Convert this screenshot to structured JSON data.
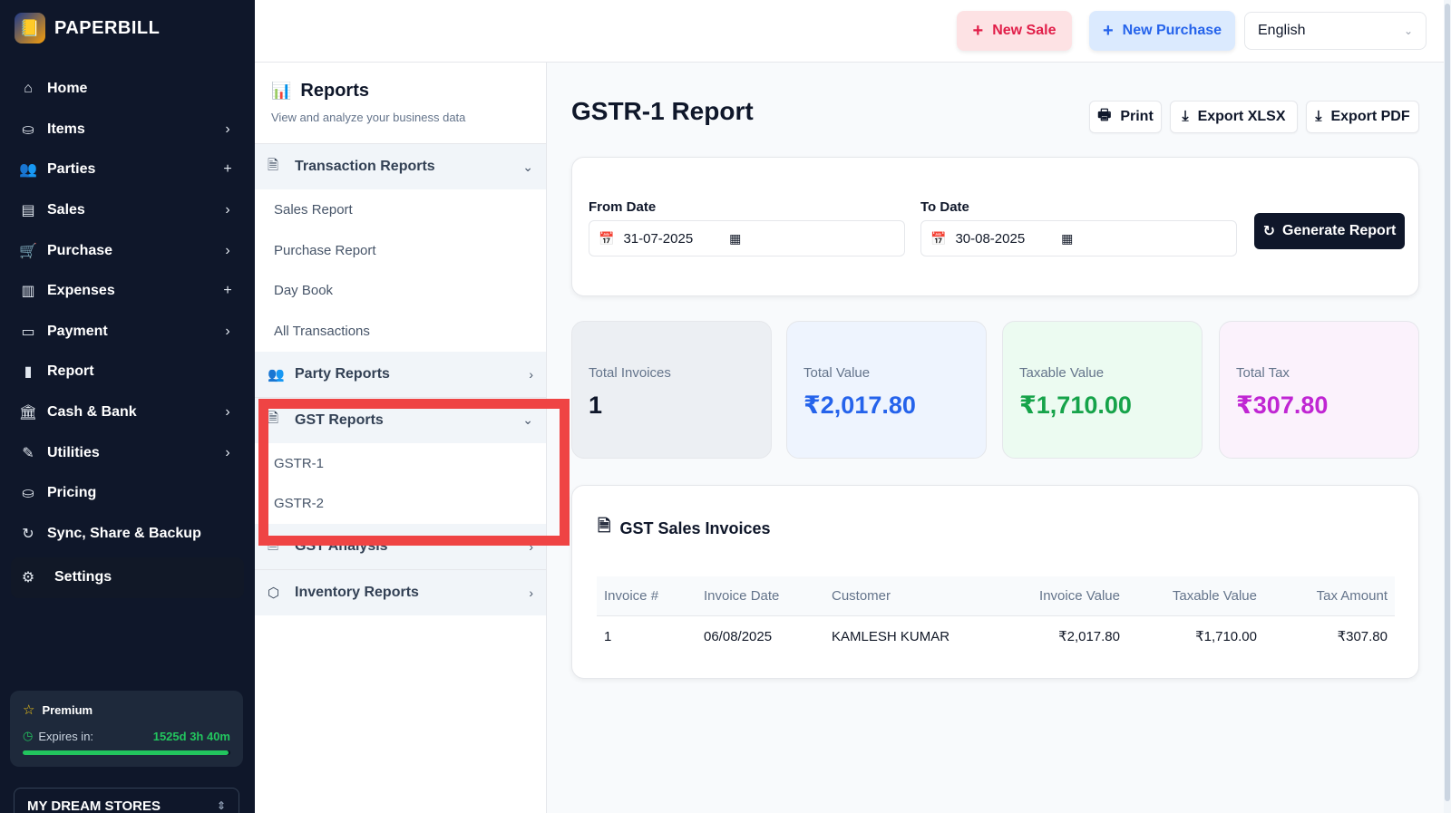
{
  "brand": {
    "name": "PAPERBILL",
    "logo_icon": "📒"
  },
  "sidebar": {
    "items": [
      {
        "label": "Home",
        "icon": "⌂",
        "right": "",
        "name": "home"
      },
      {
        "label": "Items",
        "icon": "⛀",
        "right": "›",
        "name": "items"
      },
      {
        "label": "Parties",
        "icon": "👥",
        "right": "+",
        "name": "parties"
      },
      {
        "label": "Sales",
        "icon": "▤",
        "right": "›",
        "name": "sales"
      },
      {
        "label": "Purchase",
        "icon": "🛒",
        "right": "›",
        "name": "purchase"
      },
      {
        "label": "Expenses",
        "icon": "▥",
        "right": "+",
        "name": "expenses"
      },
      {
        "label": "Payment",
        "icon": "▭",
        "right": "›",
        "name": "payment"
      },
      {
        "label": "Report",
        "icon": "▮",
        "right": "",
        "name": "report"
      },
      {
        "label": "Cash & Bank",
        "icon": "🏛",
        "right": "›",
        "name": "cash-bank"
      },
      {
        "label": "Utilities",
        "icon": "✎",
        "right": "›",
        "name": "utilities"
      },
      {
        "label": "Pricing",
        "icon": "⛀",
        "right": "",
        "name": "pricing"
      },
      {
        "label": "Sync, Share & Backup",
        "icon": "↻",
        "right": "",
        "name": "sync"
      }
    ],
    "settings_label": "Settings",
    "premium": {
      "label": "Premium",
      "expires_label": "Expires in:",
      "expires_value": "1525d 3h 40m",
      "remaining_fraction": 0.99
    },
    "store_name": "MY DREAM STORES"
  },
  "topbar": {
    "new_sale": "New Sale",
    "new_purchase": "New Purchase",
    "language": "English"
  },
  "reports_panel": {
    "title": "Reports",
    "subtitle": "View and analyze your business data",
    "transaction_reports": {
      "label": "Transaction Reports",
      "items": [
        "Sales Report",
        "Purchase Report",
        "Day Book",
        "All Transactions"
      ]
    },
    "party_reports": "Party Reports",
    "gst_reports": {
      "label": "GST Reports",
      "items": [
        "GSTR-1",
        "GSTR-2"
      ]
    },
    "gst_analysis": "GST Analysis",
    "inventory_reports": "Inventory Reports"
  },
  "main": {
    "title": "GSTR-1 Report",
    "print": "Print",
    "export_xlsx": "Export XLSX",
    "export_pdf": "Export PDF",
    "from_date_label": "From Date",
    "from_date": "31-07-2025",
    "to_date_label": "To Date",
    "to_date": "30-08-2025",
    "generate": "Generate Report",
    "stats": {
      "total_invoices": {
        "label": "Total Invoices",
        "value": "1"
      },
      "total_value": {
        "label": "Total Value",
        "value": "₹2,017.80"
      },
      "taxable_value": {
        "label": "Taxable Value",
        "value": "₹1,710.00"
      },
      "total_tax": {
        "label": "Total Tax",
        "value": "₹307.80"
      }
    },
    "table": {
      "title": "GST Sales Invoices",
      "headers": [
        "Invoice #",
        "Invoice Date",
        "Customer",
        "Invoice Value",
        "Taxable Value",
        "Tax Amount"
      ],
      "rows": [
        [
          "1",
          "06/08/2025",
          "KAMLESH KUMAR",
          "₹2,017.80",
          "₹1,710.00",
          "₹307.80"
        ]
      ]
    }
  },
  "colors": {
    "sidebar_bg": "#0f172a",
    "new_sale_text": "#e11d48",
    "new_purchase_text": "#2563eb",
    "total_value": "#2563eb",
    "taxable_value": "#16a34a",
    "total_tax": "#c026d3",
    "highlight": "#ef4444"
  }
}
